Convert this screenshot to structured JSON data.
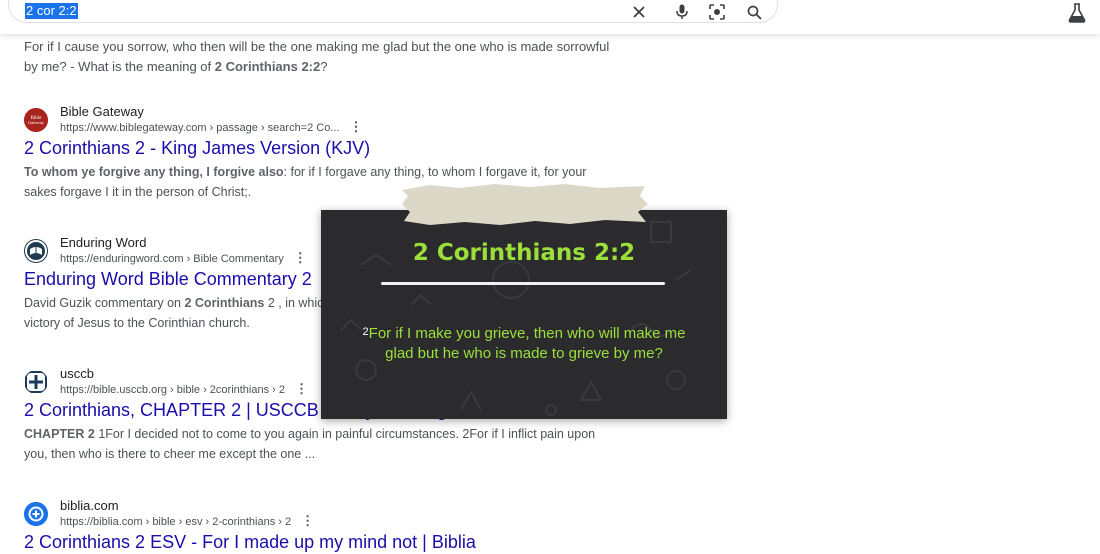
{
  "search": {
    "query": "2 cor 2:2"
  },
  "icons": {
    "clear": "close-icon",
    "voice": "microphone-icon",
    "lens": "lens-icon",
    "search": "search-icon",
    "labs": "labs-flask-icon"
  },
  "top_snippet": {
    "line1": "For if I cause you sorrow, who then will be the one making me glad but the one who is made sorrowful",
    "line2_pre": "by me? - What is the meaning of ",
    "line2_bold": "2 Corinthians 2:2",
    "line2_post": "?"
  },
  "results": [
    {
      "site": "Bible Gateway",
      "url": "https://www.biblegateway.com › passage › search=2 Co...",
      "title": "2 Corinthians 2 - King James Version (KJV)",
      "snippet_bold": "To whom ye forgive any thing, I forgive also",
      "snippet_rest": ": for if I forgave any thing, to whom I forgave it, for your",
      "snippet_line2": "sakes forgave I it in the person of Christ;."
    },
    {
      "site": "Enduring Word",
      "url": "https://enduringword.com › Bible Commentary",
      "title": "Enduring Word Bible Commentary 2",
      "snippet_pre": "David Guzik commentary on ",
      "snippet_bold": "2 Corinthians",
      "snippet_rest": " 2 , in whic",
      "snippet_line2": "victory of Jesus to the Corinthian church."
    },
    {
      "site": "usccb",
      "url": "https://bible.usccb.org › bible › 2corinthians › 2",
      "title": "2 Corinthians, CHAPTER 2 | USCCB - Daily Readings",
      "snippet_bold": "CHAPTER 2",
      "snippet_rest": " 1For I decided not to come to you again in painful circumstances. 2For if I inflict pain upon",
      "snippet_line2": "you, then who is there to cheer me except the one ..."
    },
    {
      "site": "biblia.com",
      "url": "https://biblia.com › bible › esv › 2-corinthians › 2",
      "title": "2 Corinthians 2 ESV - For I made up my mind not | Biblia"
    }
  ],
  "card": {
    "title": "2 Corinthians 2:2",
    "verse_num": "2",
    "verse_text": "For if I make you grieve, then who will make me glad but he who is made to grieve by me?",
    "accent_color": "#9be03a",
    "bg_color": "#2b2b2e"
  }
}
